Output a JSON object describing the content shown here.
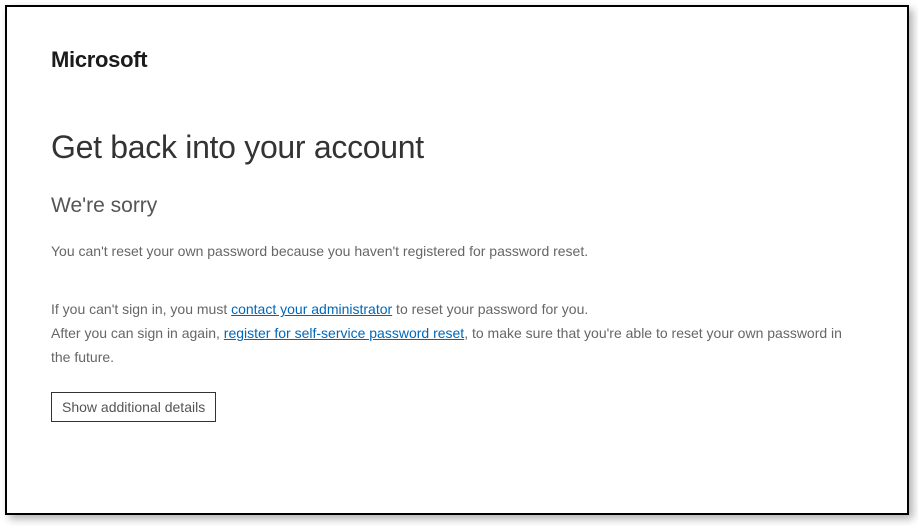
{
  "brand": "Microsoft",
  "title": "Get back into your account",
  "subtitle": "We're sorry",
  "message": "You can't reset your own password because you haven't registered for password reset.",
  "help": {
    "line1_pre": "If you can't sign in, you must ",
    "line1_link": "contact your administrator",
    "line1_post": " to reset your password for you.",
    "line2_pre": "After you can sign in again, ",
    "line2_link": "register for self-service password reset",
    "line2_post": ", to make sure that you're able to reset your own password in the future."
  },
  "buttons": {
    "details": "Show additional details"
  }
}
